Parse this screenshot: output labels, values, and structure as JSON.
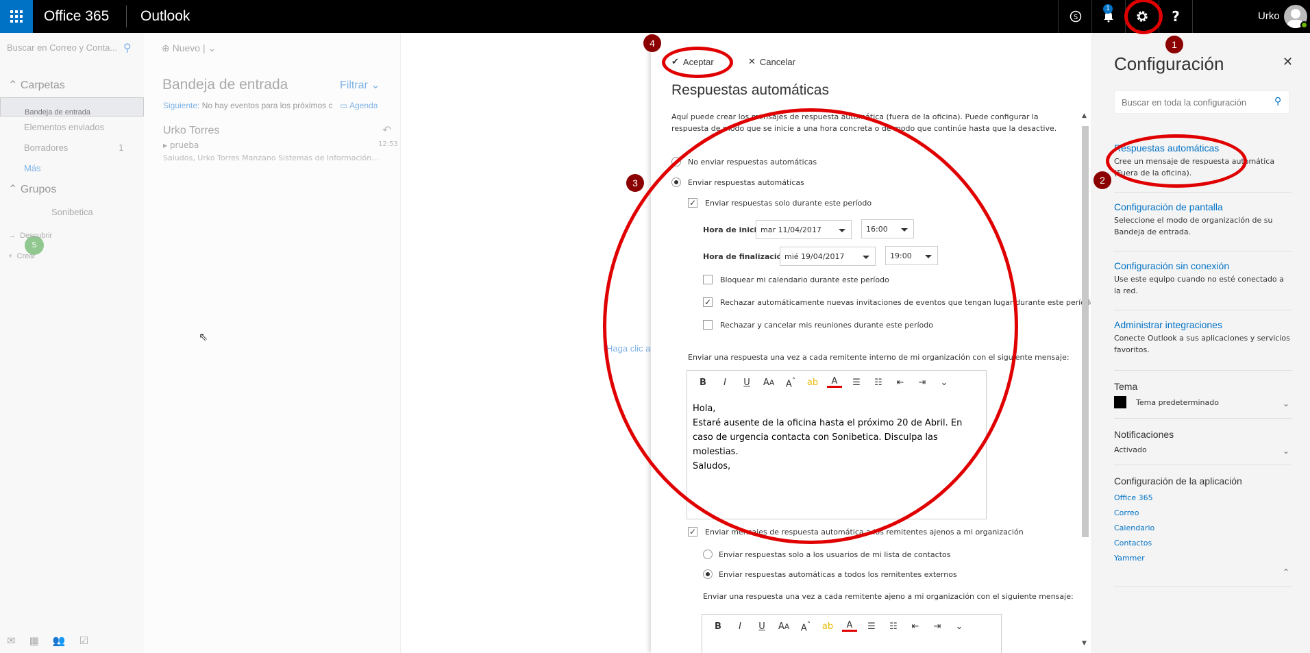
{
  "topbar": {
    "brand": "Office 365",
    "app": "Outlook",
    "notification_count": "1",
    "username": "Urko",
    "icons": [
      "app-launcher-icon",
      "skype-icon",
      "bell-icon",
      "gear-icon",
      "help-icon"
    ]
  },
  "left_nav": {
    "search_placeholder": "Buscar en Correo y Conta...",
    "folders_header": "Carpetas",
    "folders": [
      {
        "label": "Bandeja de entrada",
        "count": ""
      },
      {
        "label": "Elementos enviados",
        "count": ""
      },
      {
        "label": "Borradores",
        "count": "1"
      },
      {
        "label": "Más",
        "count": ""
      }
    ],
    "groups_header": "Grupos",
    "group": {
      "initial": "S",
      "label": "Sonibetica"
    },
    "discover": "Descubrir",
    "create": "Crear"
  },
  "message_list": {
    "new_label": "Nuevo",
    "title": "Bandeja de entrada",
    "filter": "Filtrar",
    "next_label": "Siguiente:",
    "next_text": "No hay eventos para los próximos c",
    "agenda": "Agenda",
    "message": {
      "from": "Urko Torres",
      "subject": "prueba",
      "time": "12:53",
      "preview": "Saludos,  Urko Torres Manzano Sistemas de Información..."
    }
  },
  "reading_pane": {
    "hint": "Haga clic ac"
  },
  "auto_reply": {
    "accept": "Aceptar",
    "cancel": "Cancelar",
    "title": "Respuestas automáticas",
    "description": "Aquí puede crear los mensajes de respuesta automática (fuera de la oficina). Puede configurar la respuesta de modo que se inicie a una hora concreta o de modo que continúe hasta que la desactive.",
    "opt_off": "No enviar respuestas automáticas",
    "opt_on": "Enviar respuestas automáticas",
    "only_period": "Enviar respuestas solo durante este período",
    "start_label": "Hora de inicio",
    "start_date": "mar 11/04/2017",
    "start_time": "16:00",
    "end_label": "Hora de finalización",
    "end_date": "mié 19/04/2017",
    "end_time": "19:00",
    "block_calendar": "Bloquear mi calendario durante este período",
    "decline_invites": "Rechazar automáticamente nuevas invitaciones de eventos que tengan lugar durante este período",
    "cancel_meetings": "Rechazar y cancelar mis reuniones durante este período",
    "internal_label": "Enviar una respuesta una vez a cada remitente interno de mi organización con el siguiente mensaje:",
    "internal_body": [
      "Hola,",
      "Estaré ausente de la oficina hasta el próximo 20 de Abril. En caso de urgencia contacta con Sonibetica. Disculpa las molestias.",
      "Saludos,"
    ],
    "external_toggle": "Enviar mensajes de respuesta automática a los remitentes ajenos a mi organización",
    "ext_contacts_only": "Enviar respuestas solo a los usuarios de mi lista de contactos",
    "ext_all": "Enviar respuestas automáticas a todos los remitentes externos",
    "external_label": "Enviar una respuesta una vez a cada remitente ajeno a mi organización con el siguiente mensaje:"
  },
  "config": {
    "title": "Configuración",
    "search_placeholder": "Buscar en toda la configuración",
    "items": [
      {
        "title": "Respuestas automáticas",
        "desc": "Cree un mensaje de respuesta automática (Fuera de la oficina)."
      },
      {
        "title": "Configuración de pantalla",
        "desc": "Seleccione el modo de organización de su Bandeja de entrada."
      },
      {
        "title": "Configuración sin conexión",
        "desc": "Use este equipo cuando no esté conectado a la red."
      },
      {
        "title": "Administrar integraciones",
        "desc": "Conecte Outlook a sus aplicaciones y servicios favoritos."
      }
    ],
    "theme_label": "Tema",
    "theme_value": "Tema predeterminado",
    "notif_label": "Notificaciones",
    "notif_value": "Activado",
    "app_config_label": "Configuración de la aplicación",
    "app_links": [
      "Office 365",
      "Correo",
      "Calendario",
      "Contactos",
      "Yammer"
    ]
  },
  "annotations": [
    "1",
    "2",
    "3",
    "4"
  ],
  "colors": {
    "accent": "#0072c6",
    "annotation": "#e00000",
    "badge": "#8b0000"
  }
}
